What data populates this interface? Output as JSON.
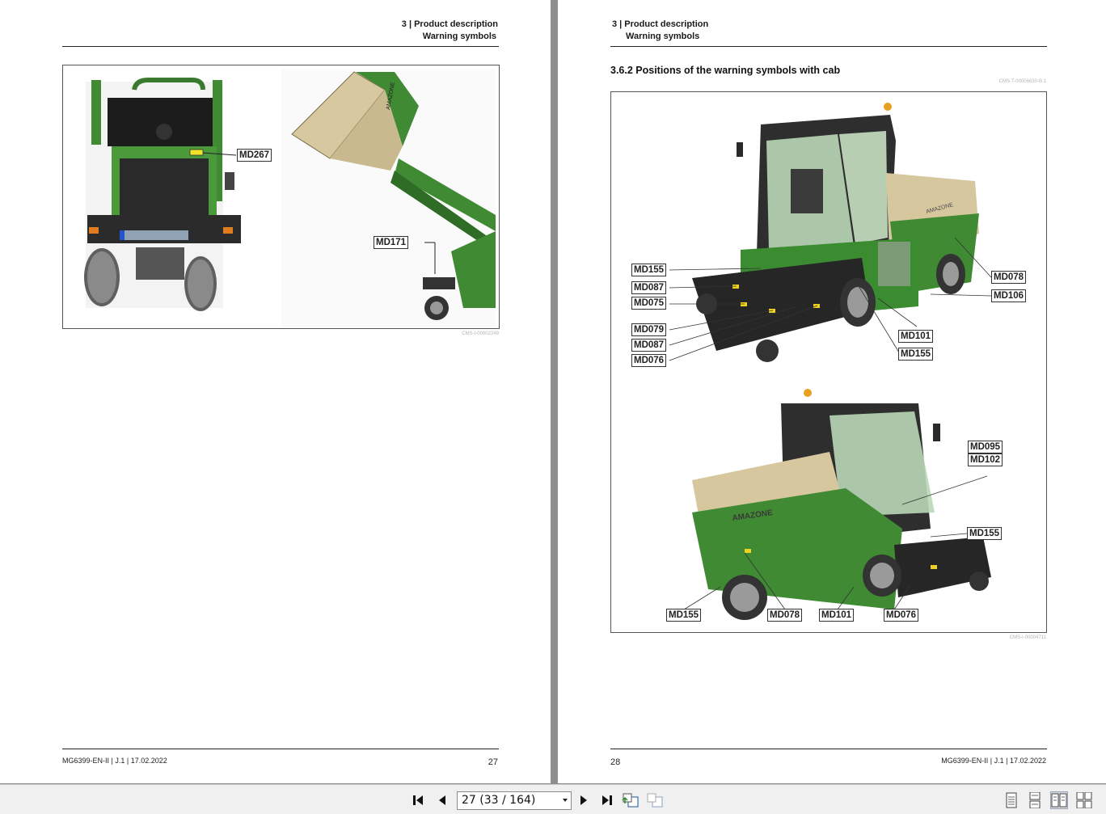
{
  "left_page": {
    "header": {
      "chapter": "3 | Product description",
      "section": "Warning symbols"
    },
    "figure_id": "CMS-I-00002249",
    "callouts": [
      "MD267",
      "MD171"
    ],
    "footer": {
      "doc_ref": "MG6399-EN-II | J.1 | 17.02.2022",
      "page_number": "27"
    }
  },
  "right_page": {
    "header": {
      "chapter": "3 | Product description",
      "section": "Warning symbols"
    },
    "section_title": "3.6.2  Positions of the warning symbols with cab",
    "top_id": "CMS-T-00006630-B.1",
    "figure_id": "CMS-I-00004711",
    "brand": "AMAZONE",
    "callouts_top": [
      "MD155",
      "MD087",
      "MD075",
      "MD079",
      "MD087",
      "MD076",
      "MD078",
      "MD106",
      "MD101",
      "MD155"
    ],
    "callouts_bottom": [
      "MD095",
      "MD102",
      "MD155",
      "MD155",
      "MD078",
      "MD101",
      "MD076"
    ],
    "footer": {
      "doc_ref": "MG6399-EN-II | J.1 | 17.02.2022",
      "page_number": "28"
    }
  },
  "toolbar": {
    "page_indicator": "27 (33 / 164)",
    "icons": [
      "first-page-icon",
      "previous-page-icon",
      "next-page-icon",
      "last-page-icon",
      "go-back-icon",
      "go-forward-icon",
      "single-page-icon",
      "continuous-icon",
      "facing-pages-icon",
      "continuous-facing-icon"
    ]
  },
  "colors": {
    "machine_green": "#3f8a33",
    "hopper_tan": "#d8c8a0",
    "toolbar_bg": "#f0f0f0",
    "viewer_bg": "#8e8e8e"
  }
}
